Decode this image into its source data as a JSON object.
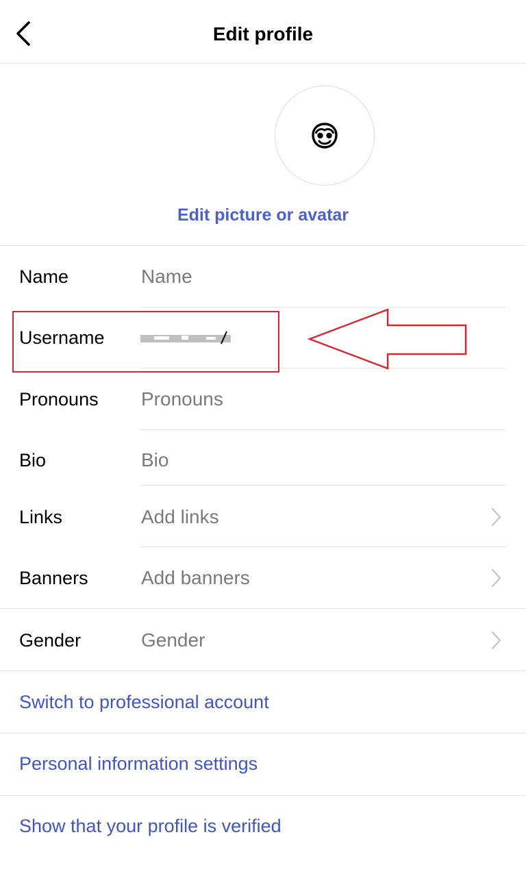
{
  "header": {
    "title": "Edit profile"
  },
  "avatar": {
    "edit_label": "Edit picture or avatar"
  },
  "fields": {
    "name": {
      "label": "Name",
      "placeholder": "Name"
    },
    "username": {
      "label": "Username",
      "value": ""
    },
    "pronouns": {
      "label": "Pronouns",
      "placeholder": "Pronouns"
    },
    "bio": {
      "label": "Bio",
      "placeholder": "Bio"
    },
    "links": {
      "label": "Links",
      "placeholder": "Add links"
    },
    "banners": {
      "label": "Banners",
      "placeholder": "Add banners"
    },
    "gender": {
      "label": "Gender",
      "placeholder": "Gender"
    }
  },
  "actions": {
    "switch_professional": "Switch to professional account",
    "personal_info": "Personal information settings",
    "show_verified": "Show that your profile is verified"
  },
  "annotation": {
    "color": "#d8242f"
  },
  "colors": {
    "link_blue": "#3f55c8",
    "placeholder_gray": "#7a7a7a"
  }
}
